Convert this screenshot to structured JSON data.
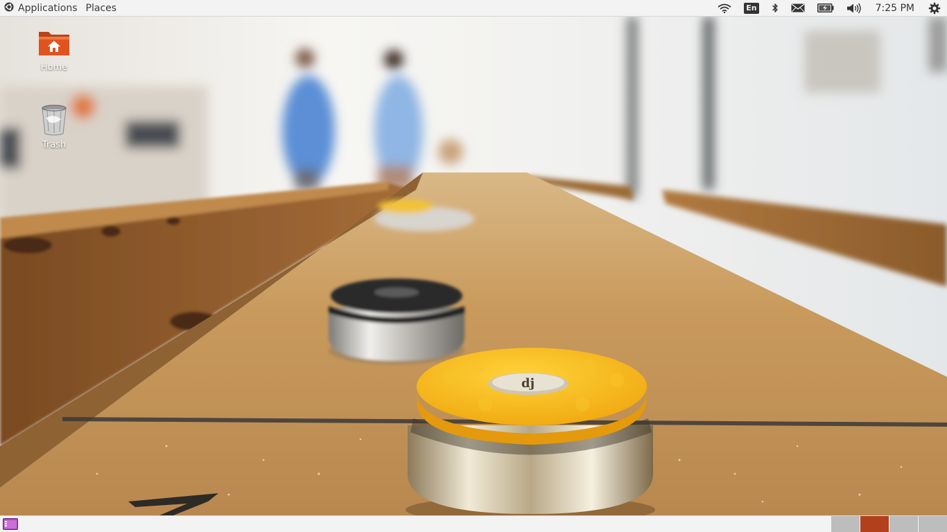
{
  "top_panel": {
    "menus": [
      {
        "label": "Applications",
        "icon": "ubuntu-logo-icon"
      },
      {
        "label": "Places"
      }
    ],
    "indicators": [
      {
        "name": "network",
        "icon": "wifi-icon"
      },
      {
        "name": "keyboard-layout",
        "label": "En"
      },
      {
        "name": "bluetooth",
        "icon": "bluetooth-icon"
      },
      {
        "name": "messages",
        "icon": "envelope-icon"
      },
      {
        "name": "battery",
        "icon": "battery-charging-icon"
      },
      {
        "name": "sound",
        "icon": "speaker-icon"
      }
    ],
    "clock": "7:25 PM",
    "session_icon": "gear-icon"
  },
  "desktop": {
    "icons": [
      {
        "label": "Home",
        "icon": "home-folder-icon"
      },
      {
        "label": "Trash",
        "icon": "trash-icon"
      }
    ]
  },
  "bottom_panel": {
    "show_desktop_icon": "show-desktop-icon",
    "workspaces": {
      "count": 4,
      "active_index": 1
    }
  },
  "colors": {
    "panel_bg": "#f3f3f3",
    "accent": "#b3401d",
    "folder_orange": "#e0531f",
    "puck_yellow": "#f4b21a"
  }
}
